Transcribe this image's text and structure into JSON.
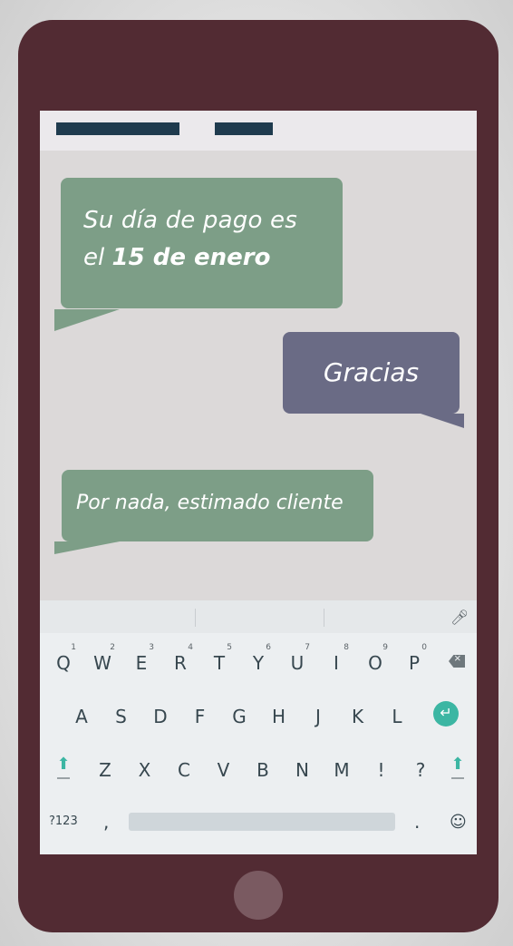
{
  "messages": [
    {
      "from": "incoming",
      "line1": "Su día de pago es",
      "line2_pre": "el ",
      "line2_bold": "15 de enero"
    },
    {
      "from": "outgoing",
      "text": "Gracias"
    },
    {
      "from": "incoming",
      "text": "Por nada, estimado cliente"
    }
  ],
  "keyboard": {
    "row1": [
      {
        "k": "Q",
        "n": "1"
      },
      {
        "k": "W",
        "n": "2"
      },
      {
        "k": "E",
        "n": "3"
      },
      {
        "k": "R",
        "n": "4"
      },
      {
        "k": "T",
        "n": "5"
      },
      {
        "k": "Y",
        "n": "6"
      },
      {
        "k": "U",
        "n": "7"
      },
      {
        "k": "I",
        "n": "8"
      },
      {
        "k": "O",
        "n": "9"
      },
      {
        "k": "P",
        "n": "0"
      }
    ],
    "row2": [
      "A",
      "S",
      "D",
      "F",
      "G",
      "H",
      "J",
      "K",
      "L"
    ],
    "row3": [
      "Z",
      "X",
      "C",
      "V",
      "B",
      "N",
      "M",
      "!",
      "?"
    ],
    "row4": {
      "symbols": "?123",
      "comma": ",",
      "period": ".",
      "emoji": "☺"
    },
    "icons": {
      "mic": "microphone-icon",
      "backspace": "backspace-icon",
      "enter": "enter-icon",
      "shift": "shift-icon",
      "emoji": "emoji-icon"
    }
  },
  "colors": {
    "phone_body": "#522b33",
    "incoming_bubble": "#7d9e87",
    "outgoing_bubble": "#6a6b85",
    "accent": "#3cb6a3",
    "topbar_block": "#1f3b4e"
  }
}
